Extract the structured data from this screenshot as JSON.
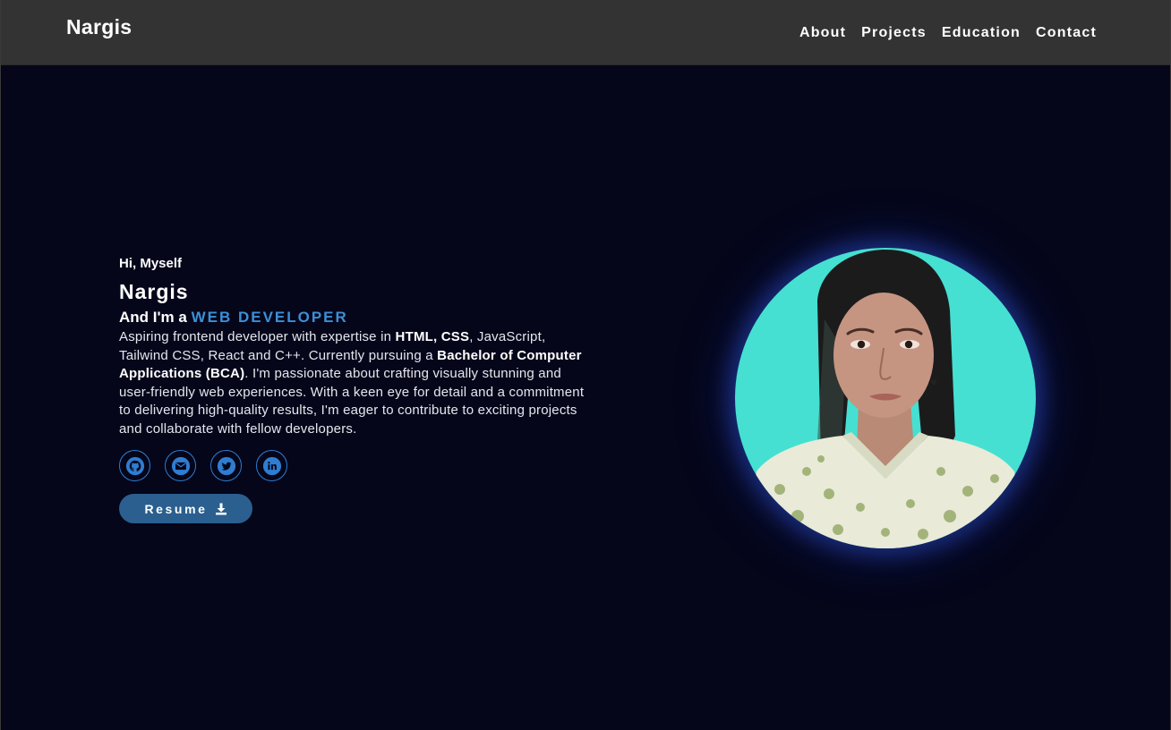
{
  "navbar": {
    "brand": "Nargis",
    "links": [
      "About",
      "Projects",
      "Education",
      "Contact"
    ]
  },
  "hero": {
    "greeting": "Hi, Myself",
    "name": "Nargis",
    "role_prefix": "And I'm a ",
    "role": "WEB DEVELOPER",
    "bio": {
      "p1": "Aspiring frontend developer with expertise in ",
      "b1": "HTML, CSS",
      "p2": ", JavaScript, Tailwind CSS, React and C++. Currently pursuing a ",
      "b2": "Bachelor of Computer Applications (BCA)",
      "p3": ". I'm passionate about crafting visually stunning and user-friendly web experiences. With a keen eye for detail and a commitment to delivering high-quality results, I'm eager to contribute to exciting projects and collaborate with fellow developers."
    },
    "socials": [
      "github-icon",
      "email-icon",
      "twitter-icon",
      "linkedin-icon"
    ],
    "resume_label": "Resume",
    "portrait": "profile-photo"
  },
  "colors": {
    "background": "#05061a",
    "navbar": "#333333",
    "accent": "#3d8fd6",
    "button": "#2a5f8f",
    "portrait_bg": "#45e0d2"
  }
}
